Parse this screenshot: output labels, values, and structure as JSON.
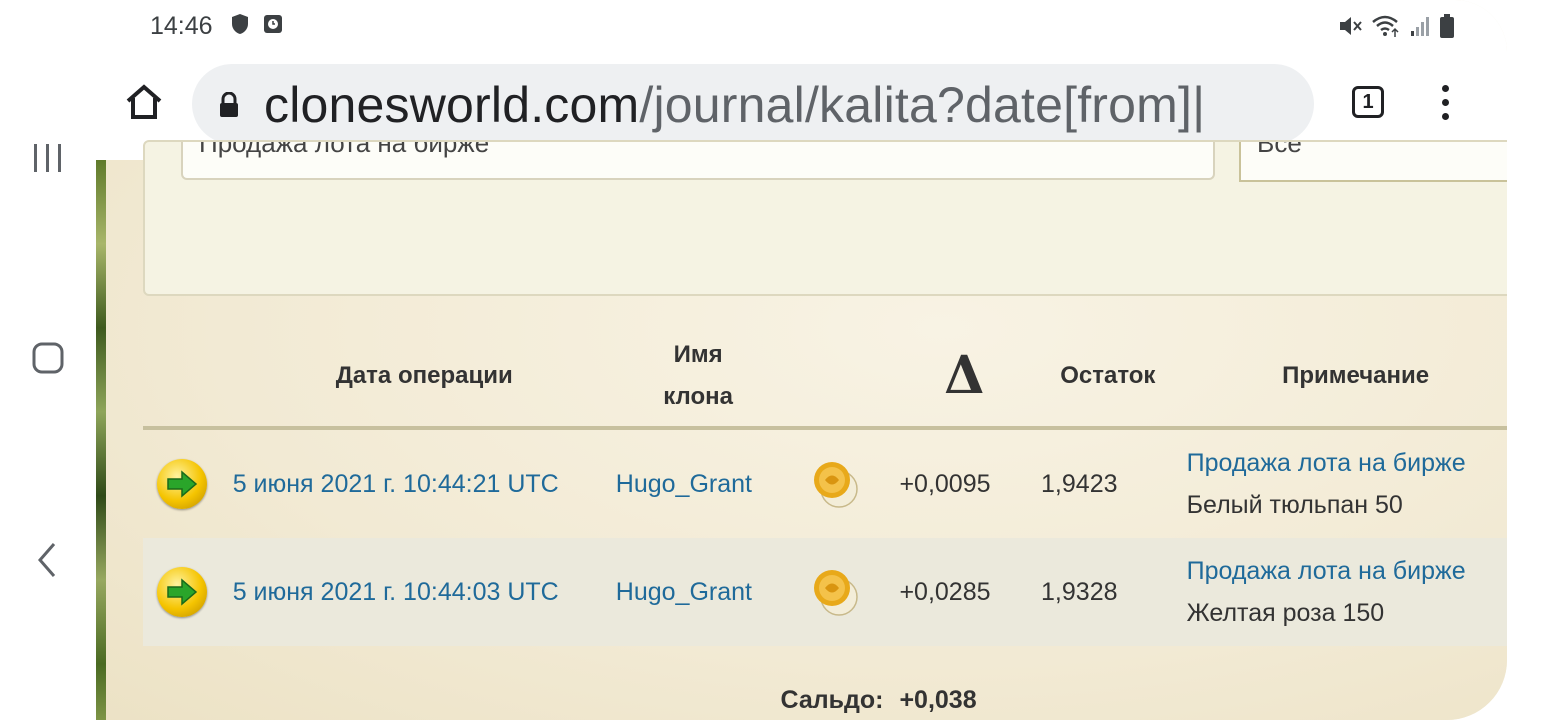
{
  "status_bar": {
    "time": "14:46",
    "icons_left": [
      "shield-icon",
      "clock-app-icon"
    ],
    "icons_right": [
      "mute-icon",
      "wifi-icon",
      "signal-icon",
      "battery-icon"
    ]
  },
  "browser": {
    "url_domain": "clonesworld.com",
    "url_path": "/journal/kalita?date[from]|",
    "tab_count": "1"
  },
  "filter": {
    "operation_value": "Продажа лота на бирже",
    "second_value": "Все"
  },
  "table": {
    "headers": {
      "date": "Дата операции",
      "clone_line1": "Имя",
      "clone_line2": "клона",
      "delta": "Δ",
      "rest": "Остаток",
      "note": "Примечание"
    },
    "rows": [
      {
        "date": "5 июня 2021 г. 10:44:21 UTC",
        "clone": "Hugo_Grant",
        "delta": "+0,0095",
        "rest": "1,9423",
        "note_link": "Продажа лота на бирже",
        "note_text": "Белый тюльпан 50",
        "extra": "sa"
      },
      {
        "date": "5 июня 2021 г. 10:44:03 UTC",
        "clone": "Hugo_Grant",
        "delta": "+0,0285",
        "rest": "1,9328",
        "note_link": "Продажа лота на бирже",
        "note_text": "Желтая роза 150",
        "extra": "sa"
      }
    ],
    "saldo_label": "Сальдо:",
    "saldo_value": "+0,038"
  },
  "colors": {
    "link": "#1f6a9a",
    "row_alt": "#ebe9dc",
    "page_bg": "#f4efdf"
  }
}
